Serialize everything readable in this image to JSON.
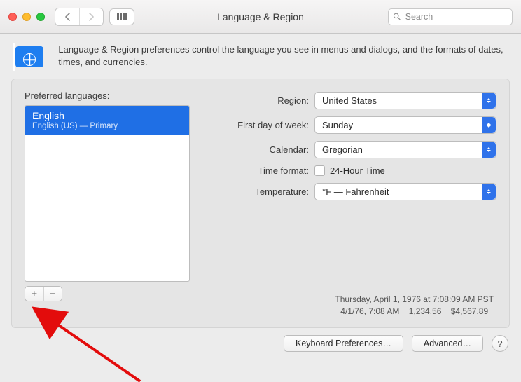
{
  "window": {
    "title": "Language & Region",
    "search_placeholder": "Search"
  },
  "description": "Language & Region preferences control the language you see in menus and dialogs, and the formats of dates, times, and currencies.",
  "preferred_languages": {
    "label": "Preferred languages:",
    "items": [
      {
        "name": "English",
        "sub": "English (US) — Primary"
      }
    ]
  },
  "settings": {
    "region": {
      "label": "Region:",
      "value": "United States"
    },
    "first_day": {
      "label": "First day of week:",
      "value": "Sunday"
    },
    "calendar": {
      "label": "Calendar:",
      "value": "Gregorian"
    },
    "time_format": {
      "label": "Time format:",
      "value": "24-Hour Time",
      "checked": false
    },
    "temperature": {
      "label": "Temperature:",
      "value": "°F — Fahrenheit"
    }
  },
  "sample": {
    "line1": "Thursday, April 1, 1976 at 7:08:09 AM PST",
    "line2": "4/1/76, 7:08 AM    1,234.56    $4,567.89"
  },
  "buttons": {
    "keyboard": "Keyboard Preferences…",
    "advanced": "Advanced…",
    "help": "?"
  }
}
